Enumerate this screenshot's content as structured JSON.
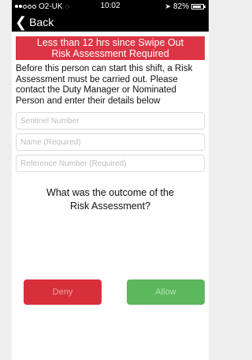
{
  "status_bar": {
    "carrier": "O2-UK",
    "time": "10:02",
    "battery": "82%",
    "battery_level": 0.82
  },
  "nav": {
    "back_label": "Back"
  },
  "alert": {
    "line1": "Less than 12 hrs since Swipe Out",
    "line2": "Risk Assessment Required"
  },
  "instructions": "Before this person can start this shift, a Risk Assessment must be carried out. Please contact the Duty Manager or Nominated Person and enter their details below",
  "form": {
    "sentinel_placeholder": "Sentinel Number",
    "name_placeholder": "Name (Required)",
    "reference_placeholder": "Reference Number (Required)"
  },
  "question": {
    "line1": "What was the outcome of the",
    "line2": "Risk Assessment?"
  },
  "actions": {
    "deny_label": "Deny",
    "allow_label": "Allow"
  },
  "colors": {
    "alert": "#dc3545",
    "deny": "#d7303a",
    "allow": "#5cb85c"
  }
}
